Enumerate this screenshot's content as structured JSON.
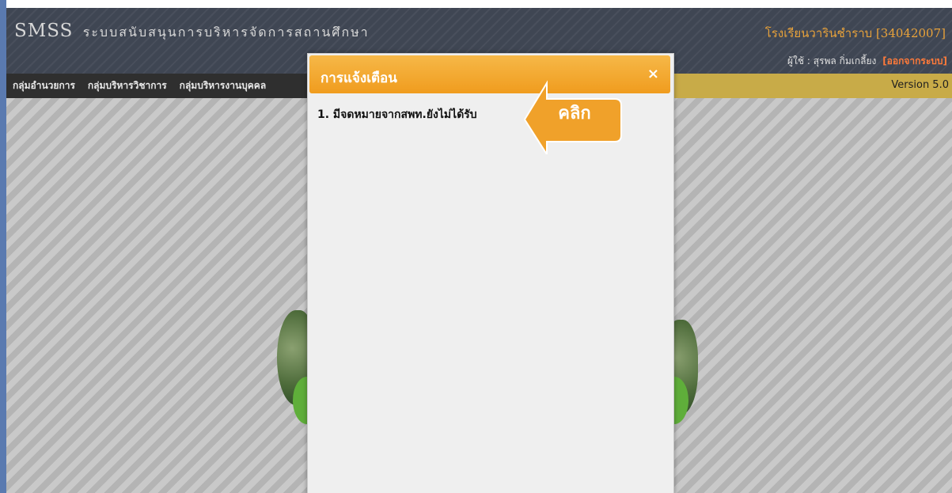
{
  "header": {
    "logo": "SMSS",
    "logo_sub": "ระบบสนับสนุนการบริหารจัดการสถานศึกษา",
    "school": "โรงเรียนวารินชำราบ [34042007]",
    "user_prefix": "ผู้ใช้ : สุรพล กิ่มเกลี้ยง",
    "logout": "[ออกจากระบบ]"
  },
  "menu": {
    "items": [
      "กลุ่มอำนวยการ",
      "กลุ่มบริหารวิชาการ",
      "กลุ่มบริหารงานบุคคล"
    ],
    "version": "Version 5.0"
  },
  "modal": {
    "title": "การแจ้งเตือน",
    "close": "×",
    "items": [
      "1. มีจดหมายจากสพท.ยังไม่ได้รับ"
    ]
  },
  "callout": {
    "label": "คลิก"
  },
  "colors": {
    "accent": "#f0a12a",
    "header": "#3f4653",
    "menu": "#c8ab48",
    "logout": "#ff7a3a"
  }
}
